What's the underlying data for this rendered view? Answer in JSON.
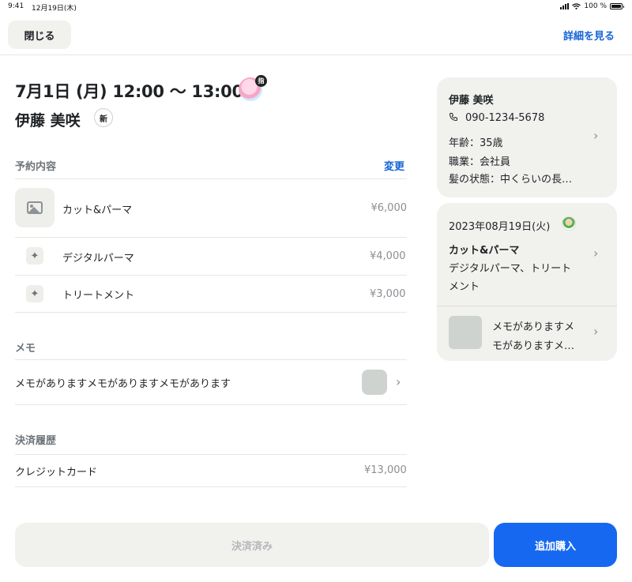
{
  "status_bar": {
    "time": "9:41",
    "date": "12月19日(木)",
    "battery": "100 %"
  },
  "nav": {
    "close_label": "閉じる",
    "detail_label": "詳細を見る"
  },
  "reservation": {
    "datetime": "7月1日 (月) 12:00 〜 13:00",
    "staff_badge": "指",
    "customer_name": "伊藤 美咲",
    "new_badge": "新"
  },
  "content_section": {
    "title": "予約内容",
    "change_label": "変更",
    "items": [
      {
        "label": "カット&パーマ",
        "price": "¥6,000"
      },
      {
        "label": "デジタルパーマ",
        "price": "¥4,000"
      },
      {
        "label": "トリートメント",
        "price": "¥3,000"
      }
    ]
  },
  "memo_section": {
    "title": "メモ",
    "text": "メモがありますメモがありますメモがあります"
  },
  "payment_section": {
    "title": "決済履歴",
    "method": "クレジットカード",
    "amount": "¥13,000"
  },
  "customer_card": {
    "name": "伊藤 美咲",
    "phone": "090-1234-5678",
    "age": "年齢：35歳",
    "job": "職業：会社員",
    "hair": "髪の状態：中くらいの長…"
  },
  "history_card": {
    "date": "2023年08月19日(火)",
    "menu": "カット&パーマ",
    "detail_line1": "デジタルパーマ、トリート",
    "detail_line2": "メント",
    "memo_line1": "メモがありますメ",
    "memo_line2": "モがありますメ…"
  },
  "footer": {
    "paid_label": "決済済み",
    "add_label": "追加購入"
  },
  "colors": {
    "accent": "#1463d6",
    "primary_button": "#1668f0",
    "card_bg": "#f1f1ee"
  }
}
